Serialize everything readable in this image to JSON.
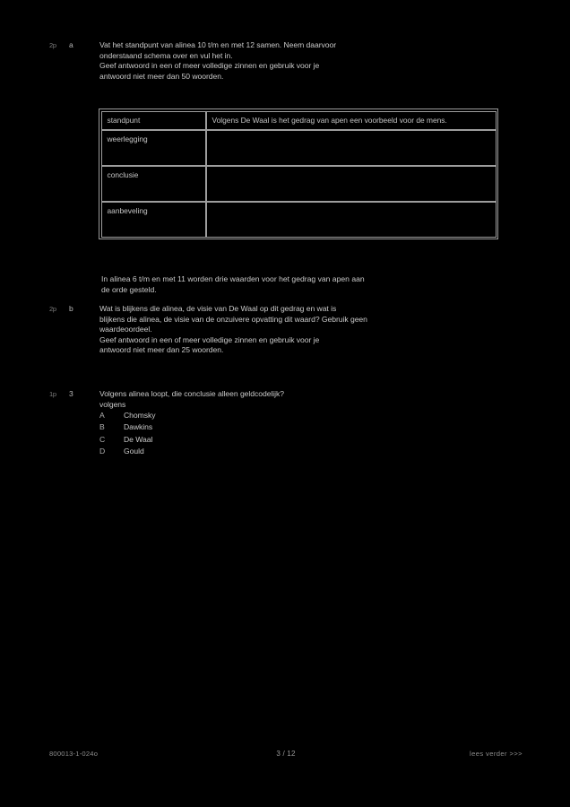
{
  "document": {
    "language": "nl",
    "page_background": "#000000",
    "text_color": "#c9c9c9"
  },
  "questions": [
    {
      "id": "q2a",
      "score": "2p",
      "letter": "a",
      "lines": [
        "Vat het standpunt van alinea 10 t/m en met 12 samen. Neem daarvoor",
        "onderstaand schema over en vul het in.",
        "Geef antwoord in een of meer volledige zinnen en gebruik voor je",
        "antwoord niet meer dan 50 woorden."
      ]
    },
    {
      "id": "q2b",
      "score": "2p",
      "letter": "b",
      "lines": [
        "Wat is blijkens die alinea, de visie van  De Waal op dit gedrag en wat is",
        "blijkens die alinea, de visie van de onzuivere opvatting dit waard? Gebruik geen",
        "waardeoordeel.",
        "Geef antwoord in een of meer volledige zinnen en gebruik voor je",
        "antwoord niet meer dan 25 woorden."
      ]
    },
    {
      "id": "q3",
      "score": "1p",
      "letter": "3",
      "lines": [
        "Volgens alinea loopt, die conclusie alleen geldcodelijk?",
        "volgens"
      ]
    }
  ],
  "table": {
    "rows": [
      {
        "label": "standpunt",
        "value": "Volgens  De Waal is het gedrag van apen een voorbeeld voor de mens."
      },
      {
        "label": "weerlegging",
        "value": ""
      },
      {
        "label": "conclusie",
        "value": ""
      },
      {
        "label": "aanbeveling",
        "value": ""
      }
    ]
  },
  "interstitial": {
    "lines": [
      "In alinea 6 t/m en met 11 worden drie waarden voor het gedrag van apen aan",
      "de orde gesteld."
    ]
  },
  "multiple_choice": {
    "options": [
      {
        "key": "A",
        "label": "Chomsky"
      },
      {
        "key": "B",
        "label": "Dawkins"
      },
      {
        "key": "C",
        "label": "De Waal"
      },
      {
        "key": "D",
        "label": "Gould"
      }
    ]
  },
  "footer": {
    "left_code": "800013-1-024o",
    "page_number": "3 / 12",
    "right_note": "lees verder >>>"
  }
}
